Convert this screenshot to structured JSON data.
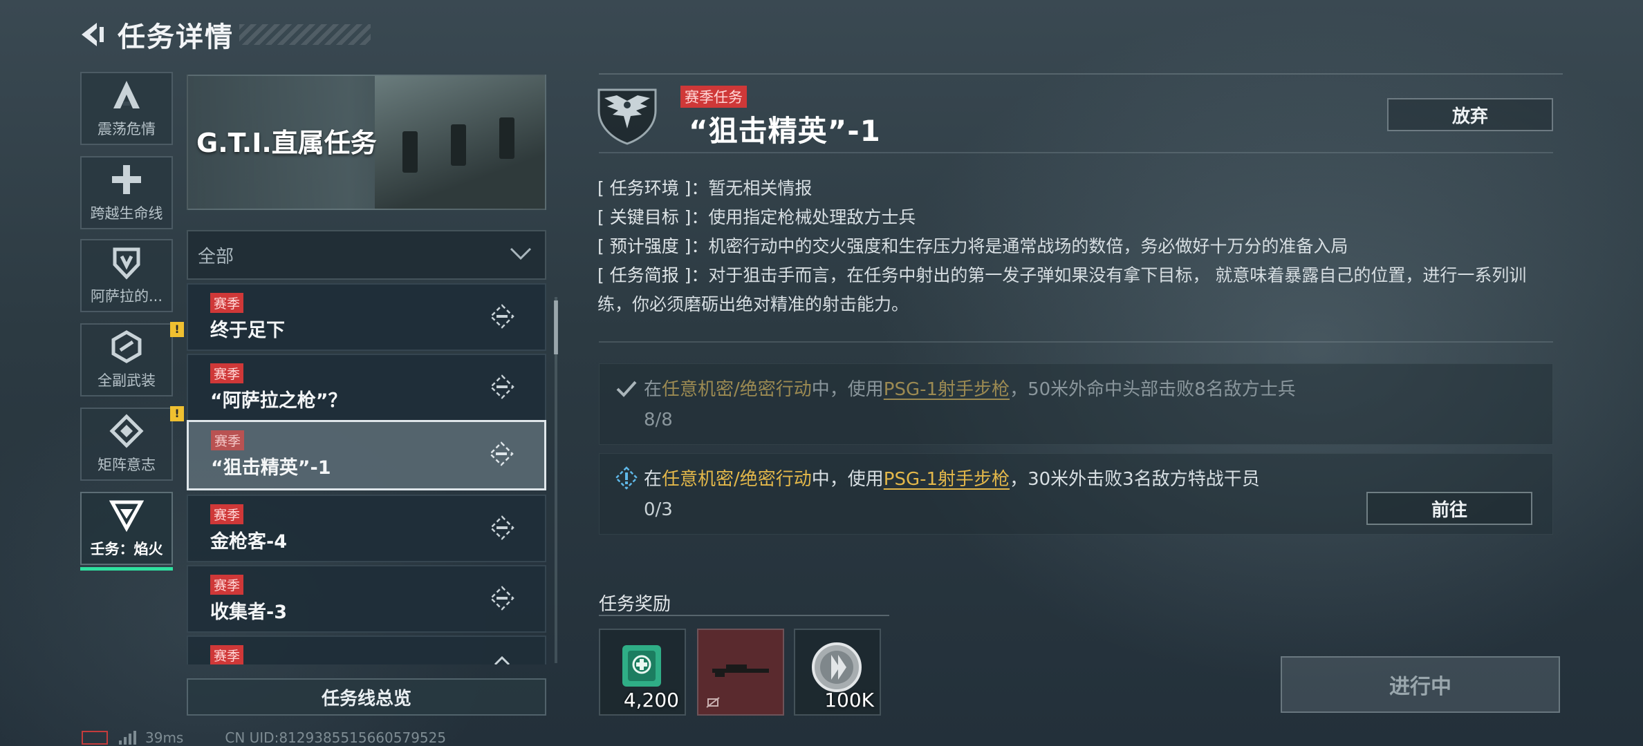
{
  "header": {
    "title": "任务详情"
  },
  "categories": [
    {
      "label": "震荡危情",
      "icon": "a-shape-icon",
      "alert": false
    },
    {
      "label": "跨越生命线",
      "icon": "plus-icon",
      "alert": false
    },
    {
      "label": "阿萨拉的...",
      "icon": "shield-icon",
      "alert": false
    },
    {
      "label": "全副武装",
      "icon": "hex-badge-icon",
      "alert": true
    },
    {
      "label": "矩阵意志",
      "icon": "matrix-icon",
      "alert": true
    },
    {
      "label": "壬务：焰火",
      "icon": "triangle-v-icon",
      "alert": false,
      "active": true
    }
  ],
  "alert_mark": "!",
  "banner": {
    "text": "G.T.I.直属任务"
  },
  "filter": {
    "value": "全部"
  },
  "tasks": [
    {
      "tag": "赛季",
      "name": "终于足下"
    },
    {
      "tag": "赛季",
      "name": "“阿萨拉之枪”？"
    },
    {
      "tag": "赛季",
      "name": "“狙击精英”-1",
      "selected": true
    },
    {
      "tag": "赛季",
      "name": "金枪客-4"
    },
    {
      "tag": "赛季",
      "name": "收集者-3"
    },
    {
      "tag": "赛季",
      "name": ""
    }
  ],
  "overview_button": "任务线总览",
  "statusbar": {
    "ping": "39ms",
    "uid": "CN UID:8129385515660579525"
  },
  "detail": {
    "tag": "赛季任务",
    "title": "“狙击精英”-1",
    "abandon": "放弃",
    "info": [
      {
        "key": "[ 任务环境 ]：",
        "value": "暂无相关情报"
      },
      {
        "key": "[ 关键目标 ]：",
        "value": "使用指定枪械处理敌方士兵"
      },
      {
        "key": "[ 预计强度 ]：",
        "value": "机密行动中的交火强度和生存压力将是通常战场的数倍，务必做好十万分的准备入局"
      },
      {
        "key": "[ 任务简报 ]：",
        "value": "对于狙击手而言，在任务中射出的第一发子弹如果没有拿下目标， 就意味着暴露自己的位置，进行一系列训练，你必须磨砺出绝对精准的射击能力。"
      }
    ],
    "objectives": [
      {
        "pre": "在",
        "mode": "任意机密/绝密行动",
        "mid": "中，使用",
        "weapon": "PSG-1射手步枪",
        "post": "，50米外命中头部击败8名敌方士兵",
        "progress": "8/8",
        "done": true
      },
      {
        "pre": "在",
        "mode": "任意机密/绝密行动",
        "mid": "中，使用",
        "weapon": "PSG-1射手步枪",
        "post": "，30米外击败3名敌方特战干员",
        "progress": "0/3",
        "done": false
      }
    ],
    "goto": "前往",
    "reward_title": "任务奖励",
    "rewards": [
      {
        "icon": "medkit-item-icon",
        "qty": "4,200"
      },
      {
        "icon": "rifle-item-icon",
        "qty": ""
      },
      {
        "icon": "coin-icon",
        "qty": "100K"
      }
    ],
    "status_button": "进行中"
  },
  "colors": {
    "accent_green": "#2fe0a0",
    "season_red": "#cf3838",
    "highlight_gold": "#e4b84a",
    "alert_yellow": "#f0c030"
  }
}
